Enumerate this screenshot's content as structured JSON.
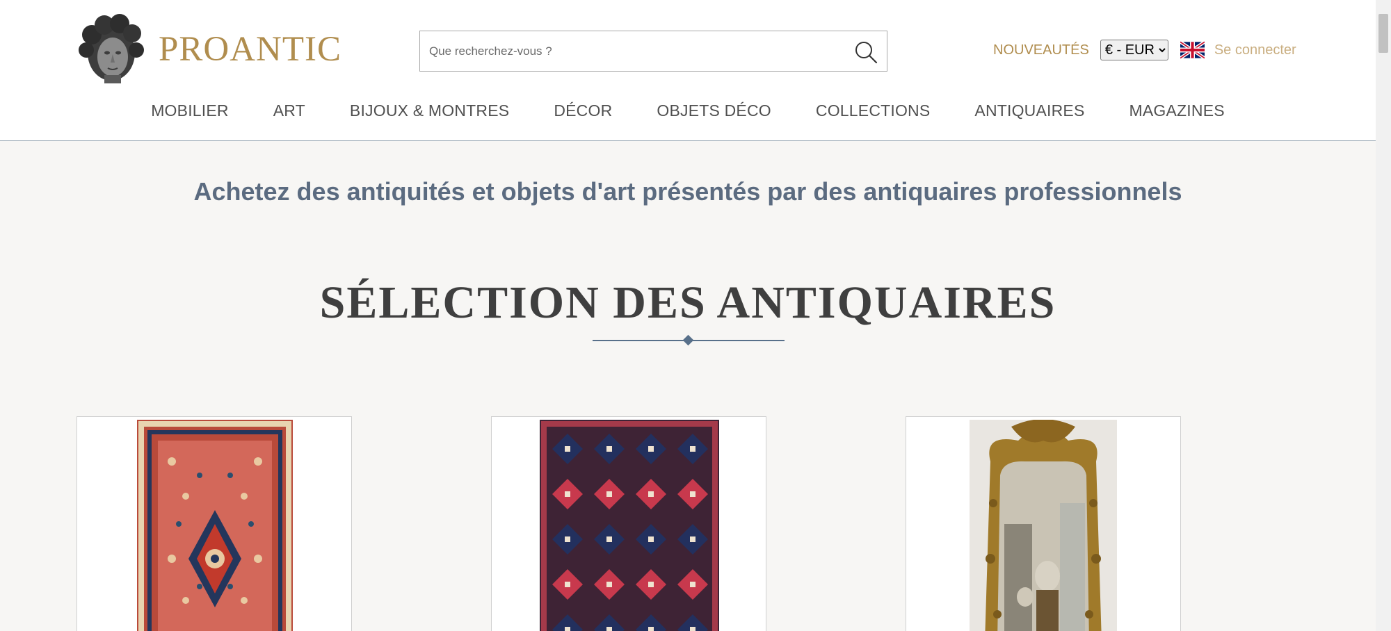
{
  "brand": {
    "name": "PROANTIC"
  },
  "search": {
    "placeholder": "Que recherchez-vous ?"
  },
  "header": {
    "new_label": "NOUVEAUTÉS",
    "currency": "€ - EUR",
    "language_flag": "uk-flag-icon",
    "login_label": "Se connecter"
  },
  "nav": {
    "items": [
      {
        "label": "MOBILIER"
      },
      {
        "label": "ART"
      },
      {
        "label": "BIJOUX & MONTRES"
      },
      {
        "label": "DÉCOR"
      },
      {
        "label": "OBJETS DÉCO"
      },
      {
        "label": "COLLECTIONS"
      },
      {
        "label": "ANTIQUAIRES"
      },
      {
        "label": "MAGAZINES"
      }
    ]
  },
  "main": {
    "subtitle": "Achetez des antiquités et objets d'art présentés par des antiquaires professionnels",
    "section_title": "SÉLECTION DES ANTIQUAIRES"
  },
  "colors": {
    "brand_gold": "#b08d4e",
    "login_gold": "#c9ae80",
    "subtitle_blue": "#5b6b80",
    "divider_blue": "#58708a",
    "background": "#f7f6f4"
  }
}
